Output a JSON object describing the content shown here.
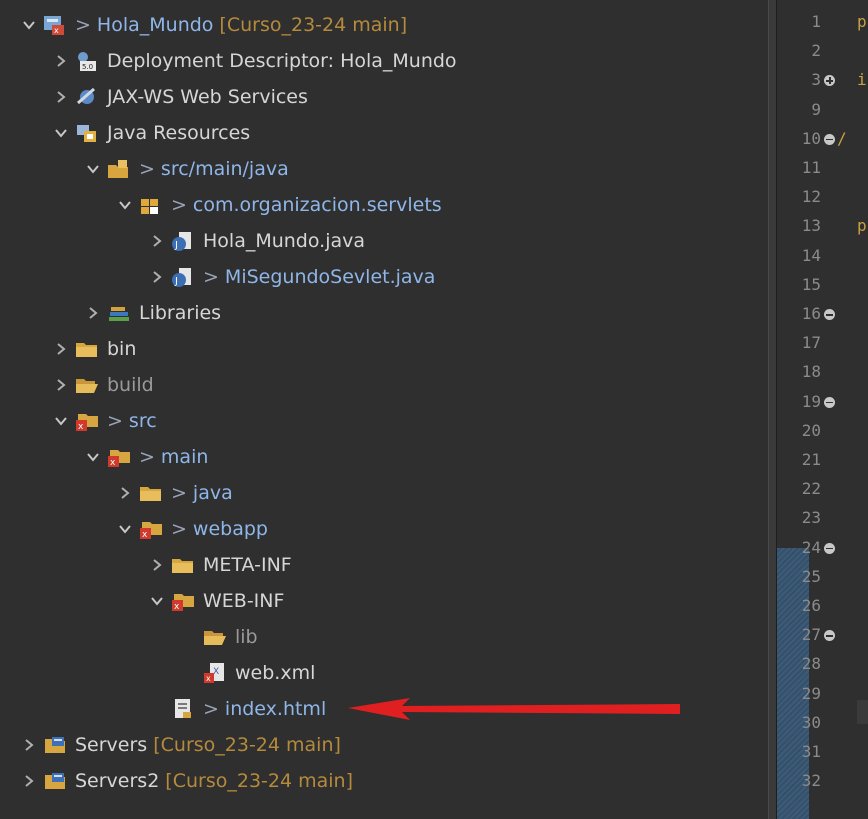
{
  "tree": [
    {
      "label": "Hola_Mundo",
      "repo": "[Curso_23-24 main]",
      "prefix": true,
      "chev": "open",
      "style": "link",
      "icon": "web-project-icon",
      "depth": 0
    },
    {
      "label": "Deployment Descriptor: Hola_Mundo",
      "prefix": false,
      "chev": "closed",
      "style": "normal",
      "icon": "deployment-descriptor-icon",
      "depth": 1
    },
    {
      "label": "JAX-WS Web Services",
      "prefix": false,
      "chev": "closed",
      "style": "normal",
      "icon": "web-services-icon",
      "depth": 1
    },
    {
      "label": "Java Resources",
      "prefix": false,
      "chev": "open",
      "style": "normal",
      "icon": "java-resources-icon",
      "depth": 1
    },
    {
      "label": "src/main/java",
      "prefix": true,
      "chev": "open",
      "style": "link",
      "icon": "source-folder-icon",
      "depth": 2
    },
    {
      "label": "com.organizacion.servlets",
      "prefix": true,
      "chev": "open",
      "style": "link",
      "icon": "package-icon",
      "depth": 3
    },
    {
      "label": "Hola_Mundo.java",
      "prefix": false,
      "chev": "closed",
      "style": "normal",
      "icon": "java-file-icon",
      "depth": 4
    },
    {
      "label": "MiSegundoSevlet.java",
      "prefix": true,
      "chev": "closed",
      "style": "link",
      "icon": "java-file-icon",
      "depth": 4
    },
    {
      "label": "Libraries",
      "prefix": false,
      "chev": "closed",
      "style": "normal",
      "icon": "libraries-icon",
      "depth": 2
    },
    {
      "label": "bin",
      "prefix": false,
      "chev": "closed",
      "style": "normal",
      "icon": "folder-icon",
      "depth": 1
    },
    {
      "label": "build",
      "prefix": false,
      "chev": "closed",
      "style": "dim",
      "icon": "open-folder-icon",
      "depth": 1
    },
    {
      "label": "src",
      "prefix": true,
      "chev": "open",
      "style": "link",
      "icon": "error-folder-icon",
      "depth": 1
    },
    {
      "label": "main",
      "prefix": true,
      "chev": "open",
      "style": "link",
      "icon": "error-folder-icon",
      "depth": 2
    },
    {
      "label": "java",
      "prefix": true,
      "chev": "closed",
      "style": "link",
      "icon": "folder-icon",
      "depth": 3
    },
    {
      "label": "webapp",
      "prefix": true,
      "chev": "open",
      "style": "link",
      "icon": "error-folder-icon",
      "depth": 3
    },
    {
      "label": "META-INF",
      "prefix": false,
      "chev": "closed",
      "style": "normal",
      "icon": "folder-icon",
      "depth": 4
    },
    {
      "label": "WEB-INF",
      "prefix": false,
      "chev": "open",
      "style": "normal",
      "icon": "error-folder-icon",
      "depth": 4
    },
    {
      "label": "lib",
      "prefix": false,
      "chev": "none",
      "style": "dim",
      "icon": "open-folder-icon",
      "depth": 5
    },
    {
      "label": "web.xml",
      "prefix": false,
      "chev": "none",
      "style": "normal",
      "icon": "xml-file-icon",
      "depth": 5
    },
    {
      "label": "index.html",
      "prefix": true,
      "chev": "none",
      "style": "link",
      "icon": "html-file-icon",
      "depth": 4
    },
    {
      "label": "Servers",
      "repo": "[Curso_23-24 main]",
      "prefix": false,
      "chev": "closed",
      "style": "normal",
      "icon": "servers-project-icon",
      "depth": 0
    },
    {
      "label": "Servers2",
      "repo": "[Curso_23-24 main]",
      "prefix": false,
      "chev": "closed",
      "style": "normal",
      "icon": "servers-project-icon",
      "depth": 0
    }
  ],
  "prefix_glyph": ">",
  "editor": {
    "lines": [
      "1",
      "2",
      "3",
      "9",
      "10",
      "11",
      "12",
      "13",
      "14",
      "15",
      "16",
      "17",
      "18",
      "19",
      "20",
      "21",
      "22",
      "23",
      "24",
      "25",
      "26",
      "27",
      "28",
      "29",
      "30",
      "31",
      "32"
    ],
    "line_chars": {
      "1": "p",
      "3": "i",
      "10": "/",
      "13": "p"
    }
  },
  "colors": {
    "arrow": "#e02020",
    "link": "#8fb6e8",
    "repo": "#b58a3c"
  }
}
